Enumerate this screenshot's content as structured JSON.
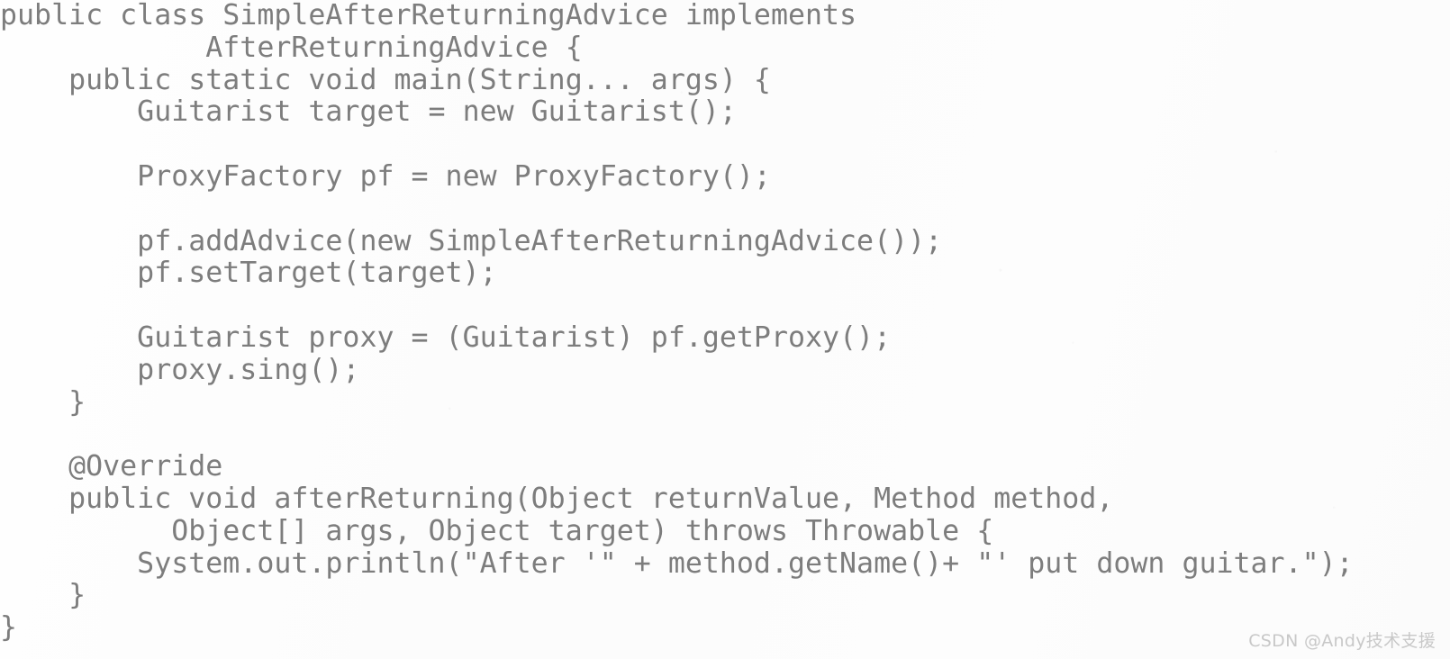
{
  "page": {
    "kind": "scanned-code-listing",
    "background_color": "#fdfdfd",
    "text_color": "#7d7d7d",
    "watermark_color": "#c8c8c8"
  },
  "code": {
    "language": "java",
    "lines": [
      "public class SimpleAfterReturningAdvice implements",
      "            AfterReturningAdvice {",
      "    public static void main(String... args) {",
      "        Guitarist target = new Guitarist();",
      "",
      "        ProxyFactory pf = new ProxyFactory();",
      "",
      "        pf.addAdvice(new SimpleAfterReturningAdvice());",
      "        pf.setTarget(target);",
      "",
      "        Guitarist proxy = (Guitarist) pf.getProxy();",
      "        proxy.sing();",
      "    }",
      "",
      "    @Override",
      "    public void afterReturning(Object returnValue, Method method,",
      "          Object[] args, Object target) throws Throwable {",
      "        System.out.println(\"After '\" + method.getName()+ \"' put down guitar.\");",
      "    }",
      "}"
    ]
  },
  "watermark": {
    "text": "CSDN @Andy技术支援"
  }
}
